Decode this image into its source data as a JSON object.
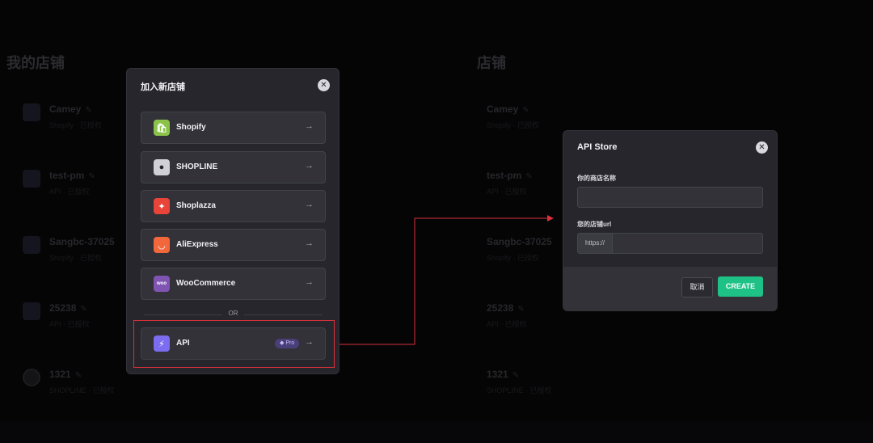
{
  "background": {
    "left_title": "我的店铺",
    "right_title": "店铺",
    "stores": [
      {
        "name": "Camey",
        "sub": "Shopify · 已授权",
        "avatar": "square"
      },
      {
        "name": "test-pm",
        "sub": "API · 已授权",
        "avatar": "square"
      },
      {
        "name": "Sangbc-37025",
        "sub": "Shopify · 已授权",
        "avatar": "square"
      },
      {
        "name": "25238",
        "sub": "API · 已授权",
        "avatar": "square"
      },
      {
        "name": "1321",
        "sub": "SHOPLINE · 已授权",
        "avatar": "round"
      }
    ],
    "edit_icon": "edit-icon"
  },
  "add_store_modal": {
    "title": "加入新店铺",
    "close_icon": "close-icon",
    "platforms": [
      {
        "label": "Shopify",
        "icon": "shopify-icon",
        "color": "#8bc34a"
      },
      {
        "label": "SHOPLINE",
        "icon": "shopline-icon",
        "color": "#d0d0d6"
      },
      {
        "label": "Shoplazza",
        "icon": "shoplazza-icon",
        "color": "#e8443a"
      },
      {
        "label": "AliExpress",
        "icon": "aliexpress-icon",
        "color": "#f2683c"
      },
      {
        "label": "WooCommerce",
        "icon": "woocommerce-icon",
        "color": "#7f54b3"
      }
    ],
    "or_text": "OR",
    "api_option": {
      "label": "API",
      "badge": "Pro",
      "icon": "api-icon",
      "color": "#7b6cf0"
    }
  },
  "api_store_modal": {
    "title": "API Store",
    "store_name_label": "你的商店名称",
    "store_name_value": "",
    "store_url_label": "您的店铺url",
    "url_prefix": "https://",
    "store_url_value": "",
    "cancel_label": "取消",
    "create_label": "CREATE",
    "accent": "#1ec287"
  },
  "highlight_color": "#d9303a"
}
